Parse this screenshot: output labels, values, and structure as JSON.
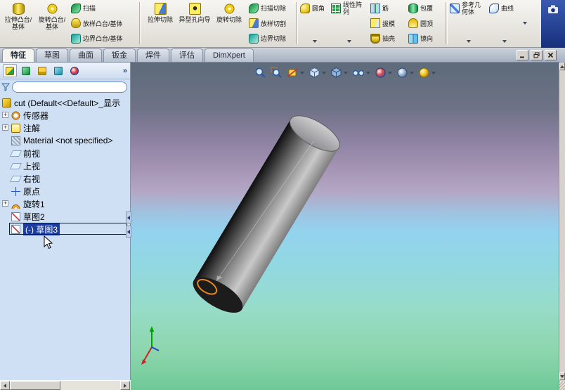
{
  "ribbon": {
    "buttons": [
      {
        "id": "extruded-boss",
        "label": "拉伸凸台/基体"
      },
      {
        "id": "revolved-boss",
        "label": "旋转凸台/基体"
      },
      {
        "id": "swept-boss",
        "label": "扫描"
      },
      {
        "id": "lofted-boss",
        "label": "放样凸台/基体"
      },
      {
        "id": "boundary-boss",
        "label": "边界凸台/基体"
      },
      {
        "id": "extruded-cut",
        "label": "拉伸切除"
      },
      {
        "id": "hole-wizard",
        "label": "异型孔向导"
      },
      {
        "id": "revolved-cut",
        "label": "旋转切除"
      },
      {
        "id": "swept-cut",
        "label": "扫描切除"
      },
      {
        "id": "lofted-cut",
        "label": "放样切割"
      },
      {
        "id": "boundary-cut",
        "label": "边界切除"
      },
      {
        "id": "fillet",
        "label": "圆角"
      },
      {
        "id": "linear-pattern",
        "label": "线性阵列"
      },
      {
        "id": "rib",
        "label": "筋"
      },
      {
        "id": "draft",
        "label": "拔模"
      },
      {
        "id": "shell",
        "label": "抽壳"
      },
      {
        "id": "wrap",
        "label": "包覆"
      },
      {
        "id": "dome",
        "label": "圆顶"
      },
      {
        "id": "mirror",
        "label": "镜向"
      },
      {
        "id": "reference-geometry",
        "label": "参考几何体"
      },
      {
        "id": "curves",
        "label": "曲线"
      }
    ]
  },
  "tabs": [
    {
      "label": "特征",
      "active": true
    },
    {
      "label": "草图",
      "active": false
    },
    {
      "label": "曲面",
      "active": false
    },
    {
      "label": "钣金",
      "active": false
    },
    {
      "label": "焊件",
      "active": false
    },
    {
      "label": "评估",
      "active": false
    },
    {
      "label": "DimXpert",
      "active": false
    }
  ],
  "tree": {
    "root": {
      "label": "cut (Default<<Default>_显示"
    },
    "items": [
      {
        "id": "sensors",
        "label": "传感器",
        "expandable": true
      },
      {
        "id": "annotations",
        "label": "注解",
        "expandable": true
      },
      {
        "id": "material",
        "label": "Material <not specified>",
        "expandable": false
      },
      {
        "id": "front-plane",
        "label": "前视",
        "expandable": false
      },
      {
        "id": "top-plane",
        "label": "上视",
        "expandable": false
      },
      {
        "id": "right-plane",
        "label": "右视",
        "expandable": false
      },
      {
        "id": "origin",
        "label": "原点",
        "expandable": false
      },
      {
        "id": "revolve1",
        "label": "旋转1",
        "expandable": true
      },
      {
        "id": "sketch2",
        "label": "草图2",
        "expandable": false
      },
      {
        "id": "sketch3",
        "label": "(-) 草图3",
        "expandable": false,
        "selected": true
      }
    ]
  },
  "icons": {
    "plus": "+",
    "chevrons": "»"
  },
  "colors": {
    "selection_bg": "#1d3d9e",
    "sketch_highlight_orange": "#e8861c",
    "viewport_top": "#5d6b7a",
    "viewport_bottom": "#6fc897"
  }
}
